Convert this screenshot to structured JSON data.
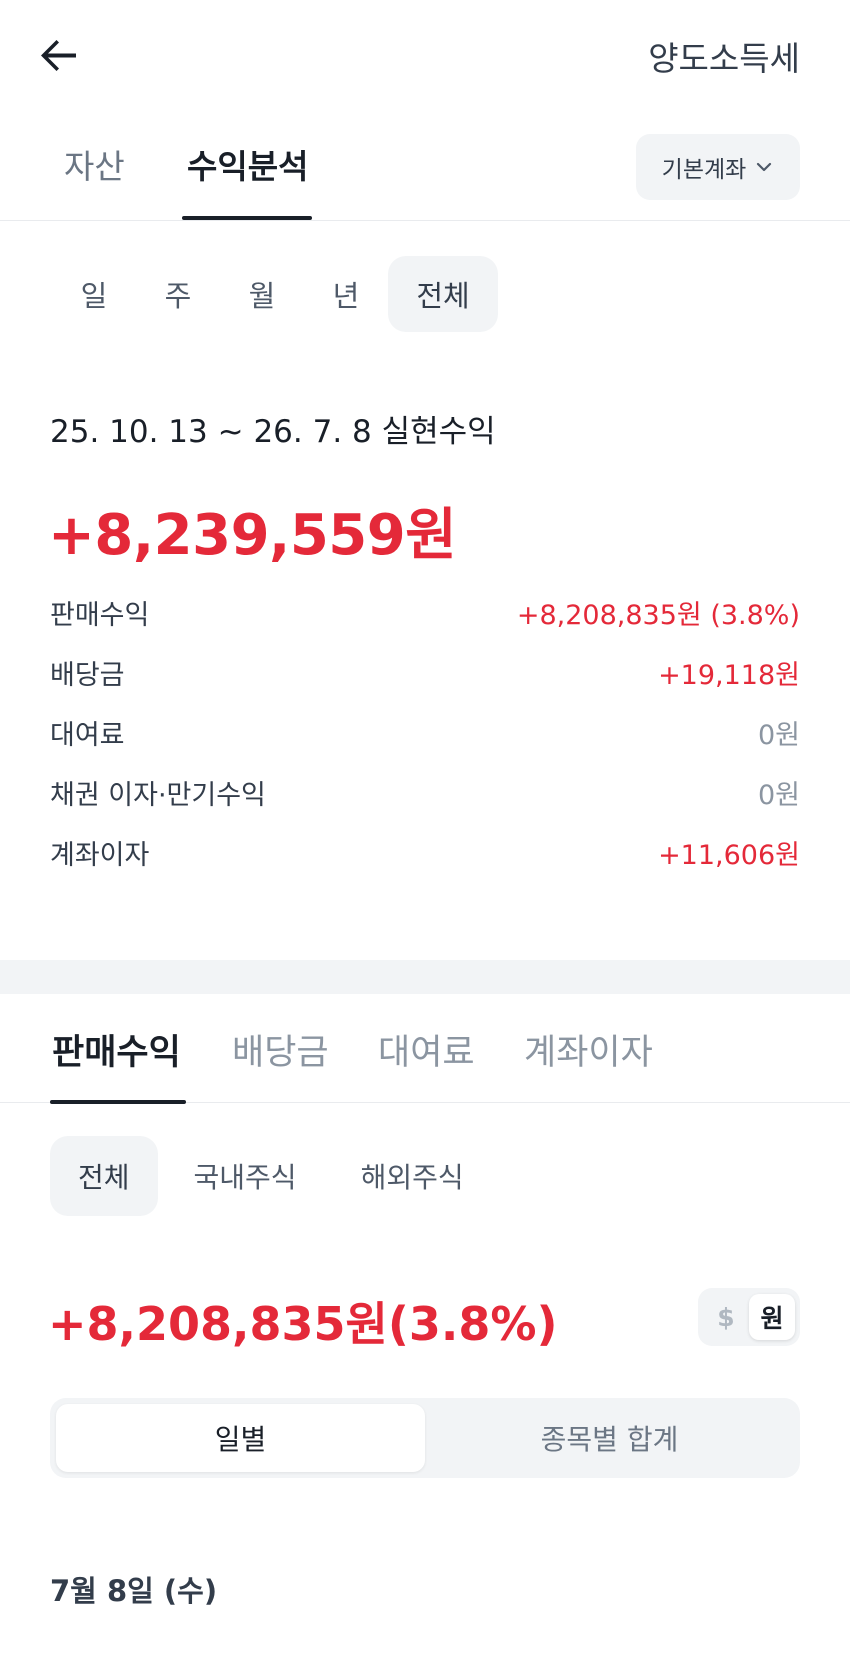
{
  "header": {
    "title": "양도소득세"
  },
  "top_tabs": [
    {
      "label": "자산"
    },
    {
      "label": "수익분석"
    }
  ],
  "account_selector": {
    "label": "기본계좌"
  },
  "period_chips": [
    {
      "label": "일"
    },
    {
      "label": "주"
    },
    {
      "label": "월"
    },
    {
      "label": "년"
    },
    {
      "label": "전체"
    }
  ],
  "summary": {
    "range_label": "25. 10. 13 ~ 26. 7. 8 실현수익",
    "total_amount": "+8,239,559원",
    "details": [
      {
        "label": "판매수익",
        "value": "+8,208,835원 (3.8%)"
      },
      {
        "label": "배당금",
        "value": "+19,118원"
      },
      {
        "label": "대여료",
        "value": "0원"
      },
      {
        "label": "채권 이자·만기수익",
        "value": "0원"
      },
      {
        "label": "계좌이자",
        "value": "+11,606원"
      }
    ]
  },
  "sub_tabs": [
    {
      "label": "판매수익"
    },
    {
      "label": "배당금"
    },
    {
      "label": "대여료"
    },
    {
      "label": "계좌이자"
    }
  ],
  "market_chips": [
    {
      "label": "전체"
    },
    {
      "label": "국내주식"
    },
    {
      "label": "해외주식"
    }
  ],
  "sale": {
    "amount": "+8,208,835원(3.8%)"
  },
  "currency_toggle": {
    "usd": "$",
    "krw": "원"
  },
  "view_toggle": {
    "daily": "일별",
    "by_stock": "종목별 합계"
  },
  "date_heading": "7월 8일 (수)",
  "colors": {
    "positive": "#e42939",
    "zero": "#8b95a1",
    "chip_bg": "#f2f4f6"
  }
}
